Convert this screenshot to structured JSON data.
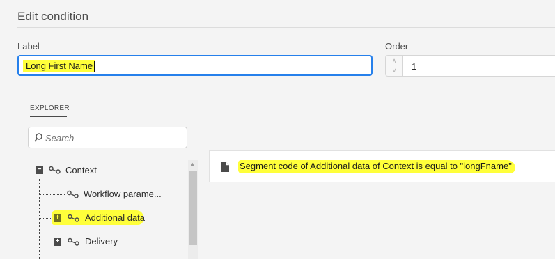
{
  "dialog": {
    "title": "Edit condition"
  },
  "label_field": {
    "caption": "Label",
    "value": "Long First Name"
  },
  "order_field": {
    "caption": "Order",
    "value": "1"
  },
  "explorer": {
    "tab_label": "EXPLORER",
    "search_placeholder": "Search",
    "tree": [
      {
        "label": "Context",
        "toggle": "−",
        "icon": "link-node-icon"
      },
      {
        "label": "Workflow parame...",
        "icon": "link-node-icon"
      },
      {
        "label": "Additional data",
        "toggle": "+",
        "icon": "link-node-icon",
        "highlighted": true
      },
      {
        "label": "Delivery",
        "toggle": "+",
        "icon": "link-node-icon"
      }
    ]
  },
  "condition": {
    "icon": "document-icon",
    "text": "Segment code of Additional data of Context is equal to \"longFname\""
  },
  "colors": {
    "highlight": "#ffff3a",
    "focus_border": "#2680eb"
  }
}
